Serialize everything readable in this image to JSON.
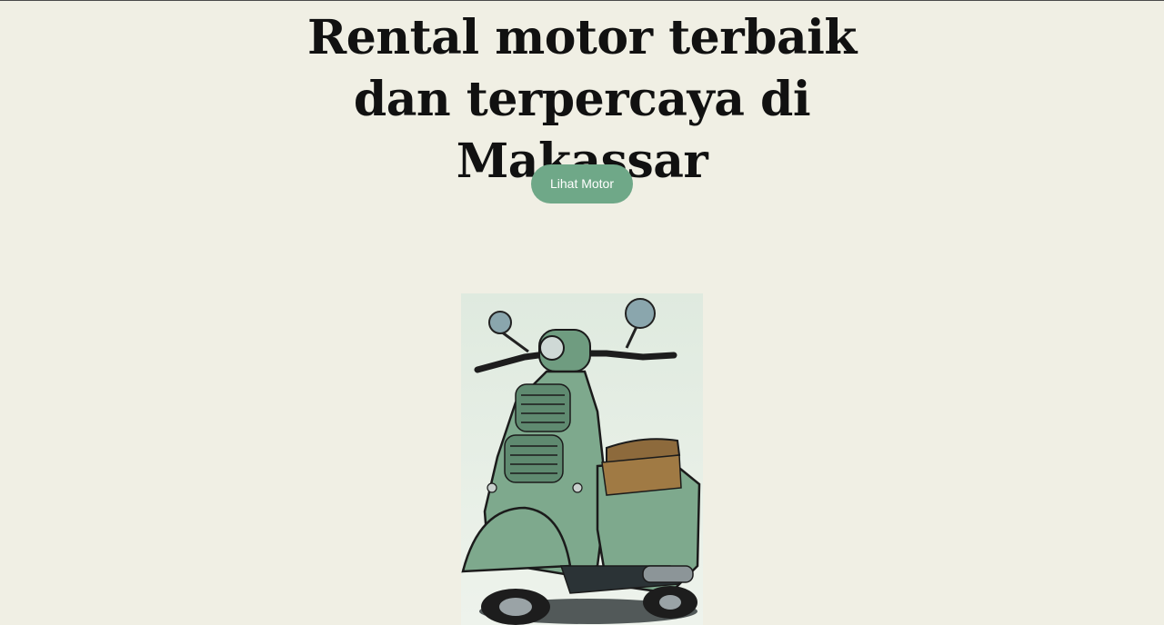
{
  "hero": {
    "title": "Rental motor terbaik dan terpercaya di Makassar",
    "button_label": "Lihat Motor"
  },
  "colors": {
    "background": "#f0efe4",
    "title": "#111111",
    "button": "#6fa888",
    "button_text": "#ffffff",
    "scooter_body": "#7ea98d"
  },
  "image": {
    "subject": "green-vespa-scooter-illustration"
  }
}
